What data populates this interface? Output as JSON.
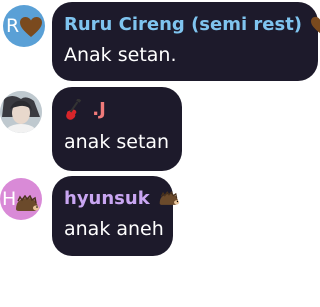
{
  "messages": [
    {
      "avatar_initial": "R",
      "avatar_color": "#5aa0d6",
      "name": "Ruru Cireng (semi rest)",
      "name_color": "#7fc4ef",
      "name_emoji": "brown-heart-icon",
      "text": "Anak setan."
    },
    {
      "avatar_color": "#c9d1d6",
      "avatar_type": "photo",
      "name_prefix_emoji": "guitar-icon",
      "name": ".J",
      "name_color": "#f07a7a",
      "text": "anak setan"
    },
    {
      "avatar_initial": "H",
      "avatar_color": "#d98ad7",
      "avatar_emoji": "hedgehog-icon",
      "name": "hyunsuk",
      "name_color": "#c9a6f2",
      "name_emoji": "hedgehog-icon",
      "text": "anak aneh"
    }
  ]
}
